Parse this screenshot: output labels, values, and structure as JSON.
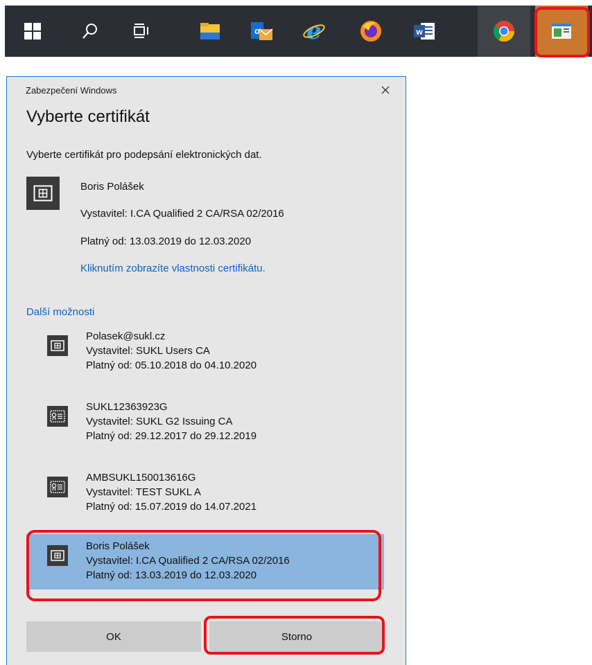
{
  "dialog": {
    "caption": "Zabezpečení Windows",
    "title": "Vyberte certifikát",
    "description": "Vyberte certifikát pro podepsání elektronických dat.",
    "selected_cert": {
      "name": "Boris Polášek",
      "issuer": "Vystavitel: I.CA Qualified 2 CA/RSA 02/2016",
      "validity": "Platný od: 13.03.2019 do 12.03.2020",
      "properties_link": "Kliknutím zobrazíte vlastnosti certifikátu."
    },
    "more_options": "Další možnosti",
    "certificates": [
      {
        "name": "Polasek@sukl.cz",
        "issuer": "Vystavitel: SUKL Users CA",
        "validity": "Platný od: 05.10.2018 do 04.10.2020",
        "icon": "certificate-card-icon"
      },
      {
        "name": "SUKL12363923G",
        "issuer": "Vystavitel: SUKL G2 Issuing CA",
        "validity": "Platný od: 29.12.2017 do 29.12.2019",
        "icon": "certificate-badge-icon"
      },
      {
        "name": "AMBSUKL150013616G",
        "issuer": "Vystavitel: TEST SUKL A",
        "validity": "Platný od: 15.07.2019 do 14.07.2021",
        "icon": "certificate-badge-icon"
      },
      {
        "name": "Boris Polášek",
        "issuer": "Vystavitel: I.CA Qualified 2 CA/RSA 02/2016",
        "validity": "Platný od: 13.03.2019 do 12.03.2020",
        "icon": "certificate-card-icon",
        "selected": true
      }
    ],
    "ok_label": "OK",
    "cancel_label": "Storno"
  },
  "taskbar": {
    "items": [
      "windows-start-icon",
      "search-icon",
      "task-view-icon",
      "file-explorer-icon",
      "outlook-icon",
      "internet-explorer-icon",
      "firefox-icon",
      "word-icon",
      "chrome-icon",
      "app-window-icon"
    ]
  },
  "colors": {
    "highlight_red": "#e8141b",
    "selection": "#8ab5de",
    "link": "#0a64c8",
    "dialog_bg": "#e6e6e6"
  }
}
